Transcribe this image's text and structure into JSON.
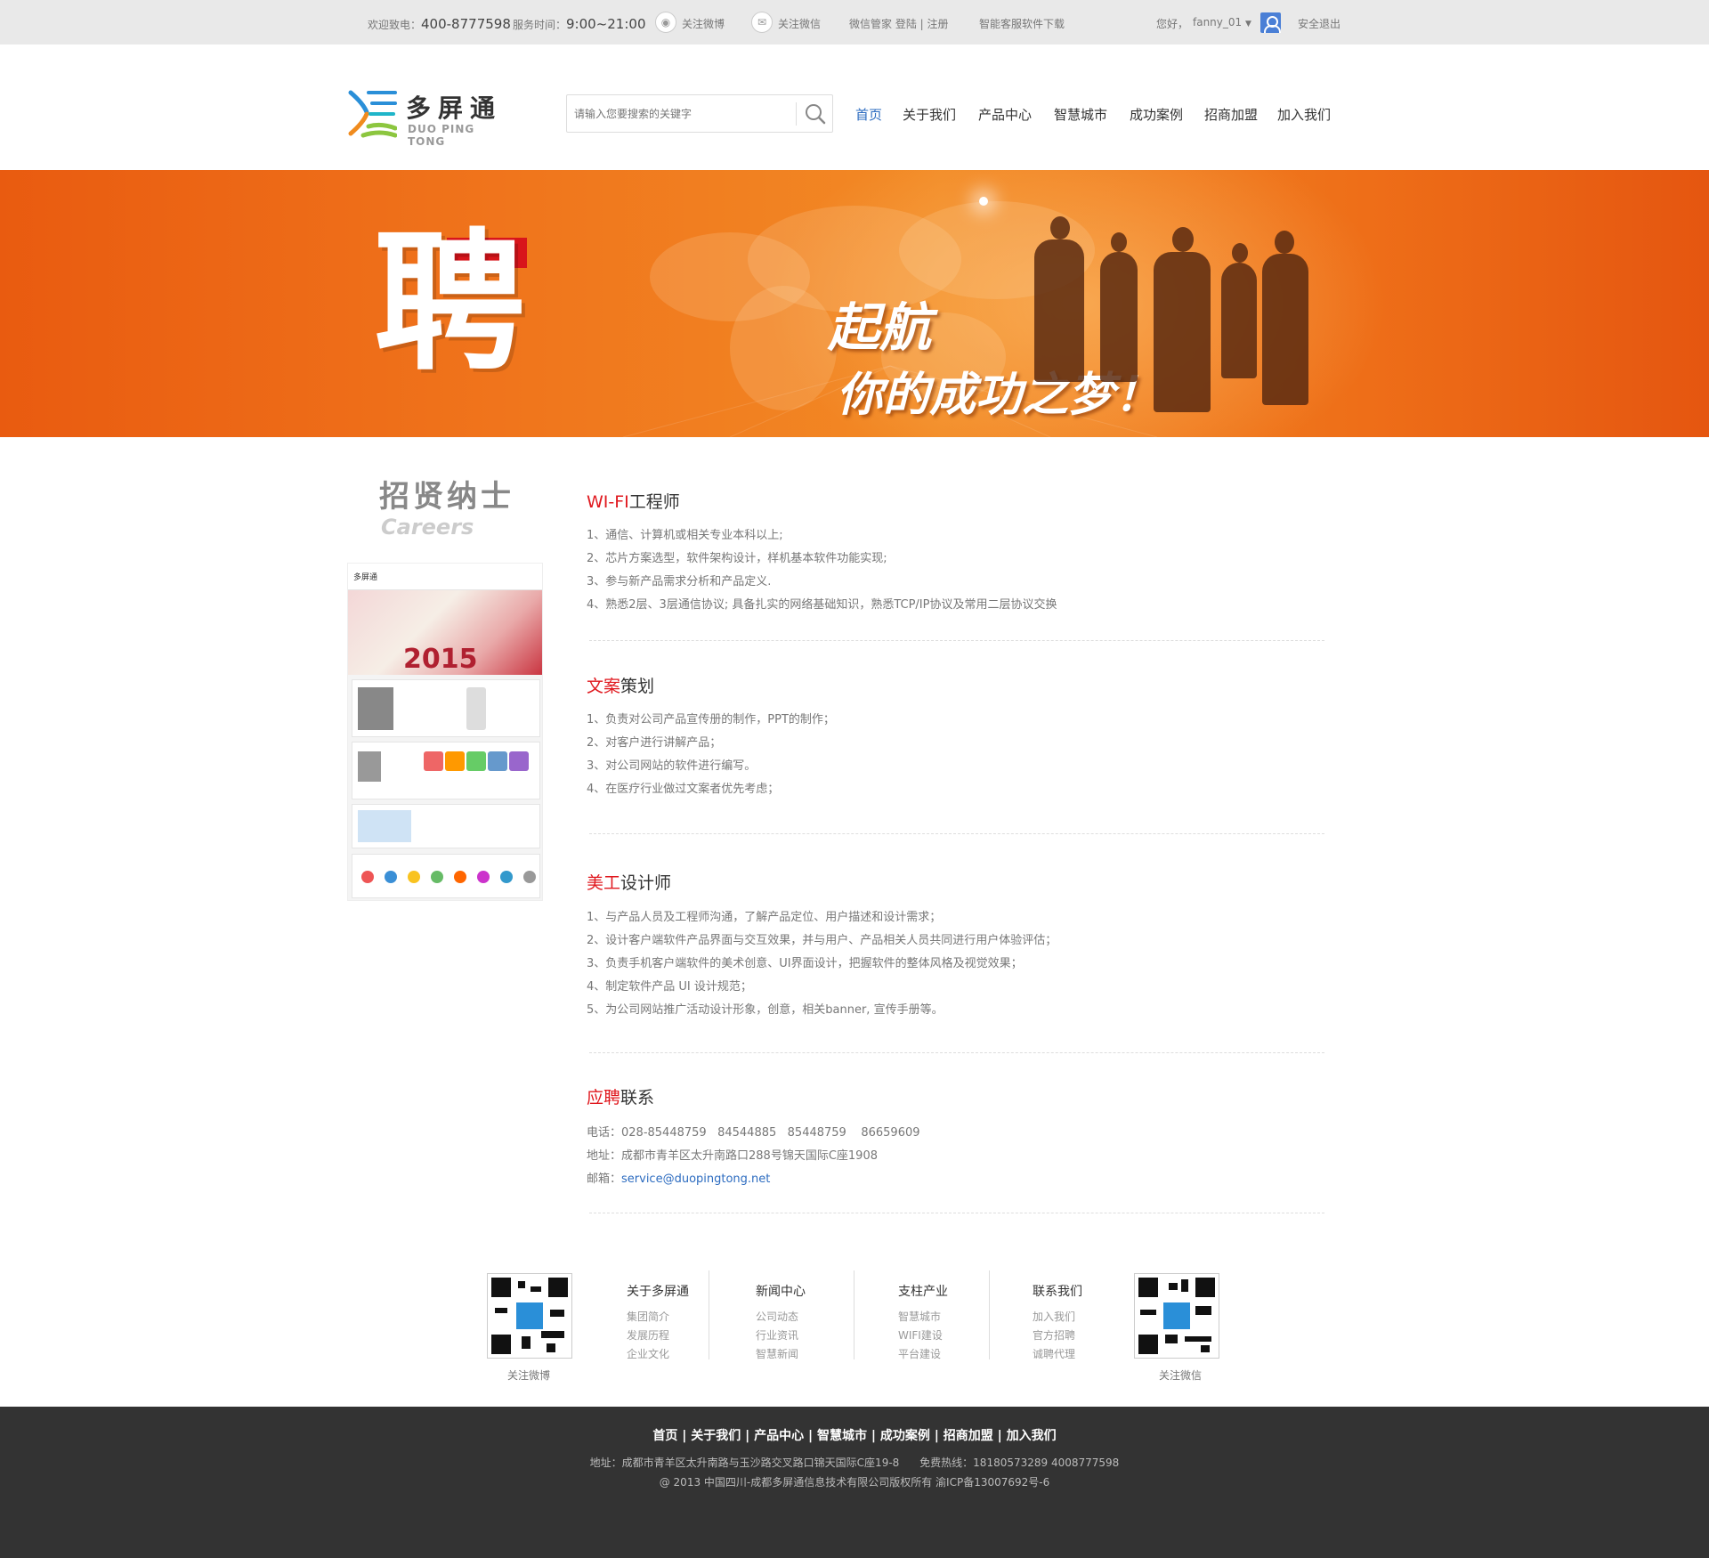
{
  "topbar": {
    "welcome_label": "欢迎致电：",
    "phone": "400-8777598",
    "hours_label": "服务时间：",
    "hours": "9:00~21:00",
    "weibo": "关注微博",
    "weixin": "关注微信",
    "wx_manager": "微信管家 登陆 | 注册",
    "download": "智能客服软件下载",
    "greeting": "您好，",
    "username": "fanny_01",
    "logout": "安全退出"
  },
  "header": {
    "logo_cn": "多屏通",
    "logo_en": "DUO PING TONG",
    "search_placeholder": "请输入您要搜索的关键字",
    "nav": [
      "首页",
      "关于我们",
      "产品中心",
      "智慧城市",
      "成功案例",
      "招商加盟",
      "加入我们"
    ]
  },
  "banner": {
    "big_char": "聘",
    "line1": "起航",
    "line2": "你的成功之梦！"
  },
  "sidebar": {
    "title": "招贤纳士",
    "subtitle": "Careers",
    "thumb_logo": "多屏通",
    "thumb_year": "2015"
  },
  "jobs": [
    {
      "title_red": "WI-FI",
      "title_rest": "工程师",
      "items": [
        "1、通信、计算机或相关专业本科以上;",
        "2、芯片方案选型，软件架构设计，样机基本软件功能实现;",
        "3、参与新产品需求分析和产品定义.",
        "4、熟悉2层、3层通信协议; 具备扎实的网络基础知识，熟悉TCP/IP协议及常用二层协议交换"
      ]
    },
    {
      "title_red": "文案",
      "title_rest": "策划",
      "items": [
        "1、负责对公司产品宣传册的制作，PPT的制作；",
        "2、对客户进行讲解产品；",
        "3、对公司网站的软件进行编写。",
        "4、在医疗行业做过文案者优先考虑；"
      ]
    },
    {
      "title_red": "美工",
      "title_rest": "设计师",
      "items": [
        "1、与产品人员及工程师沟通，了解产品定位、用户描述和设计需求；",
        "2、设计客户端软件产品界面与交互效果，并与用户、产品相关人员共同进行用户体验评估；",
        "3、负责手机客户端软件的美术创意、UI界面设计，把握软件的整体风格及视觉效果；",
        "4、制定软件产品 UI 设计规范；",
        "5、为公司网站推广活动设计形象，创意，相关banner, 宣传手册等。"
      ]
    }
  ],
  "contact": {
    "title_red": "应聘",
    "title_rest": "联系",
    "phone_label": "电话：",
    "phones": "028-85448759   84544885   85448759    86659609",
    "address_label": "地址：",
    "address": "成都市青羊区太升南路口288号锦天国际C座1908",
    "email_label": "邮箱：",
    "email": "service@duopingtong.net"
  },
  "footer": {
    "qr_left_caption": "关注微博",
    "qr_right_caption": "关注微信",
    "columns": [
      {
        "heading": "关于多屏通",
        "items": [
          "集团简介",
          "发展历程",
          "企业文化"
        ]
      },
      {
        "heading": "新闻中心",
        "items": [
          "公司动态",
          "行业资讯",
          "智慧新闻"
        ]
      },
      {
        "heading": "支柱产业",
        "items": [
          "智慧城市",
          "WIFI建设",
          "平台建设"
        ]
      },
      {
        "heading": "联系我们",
        "items": [
          "加入我们",
          "官方招聘",
          "诚聘代理"
        ]
      }
    ]
  },
  "bottom": {
    "nav": "首页 | 关于我们 | 产品中心 | 智慧城市 | 成功案例 | 招商加盟 | 加入我们",
    "address": "地址：成都市青羊区太升南路与玉沙路交叉路口锦天国际C座19-8      免费热线：18180573289 4008777598",
    "copyright": "@ 2013 中国四川-成都多屏通信息技术有限公司版权所有 渝ICP备13007692号-6"
  },
  "colors": {
    "accent_red": "#e0181e",
    "nav_active": "#2d6cc0",
    "banner_orange": "#f0751c",
    "footer_bg": "#333333"
  }
}
